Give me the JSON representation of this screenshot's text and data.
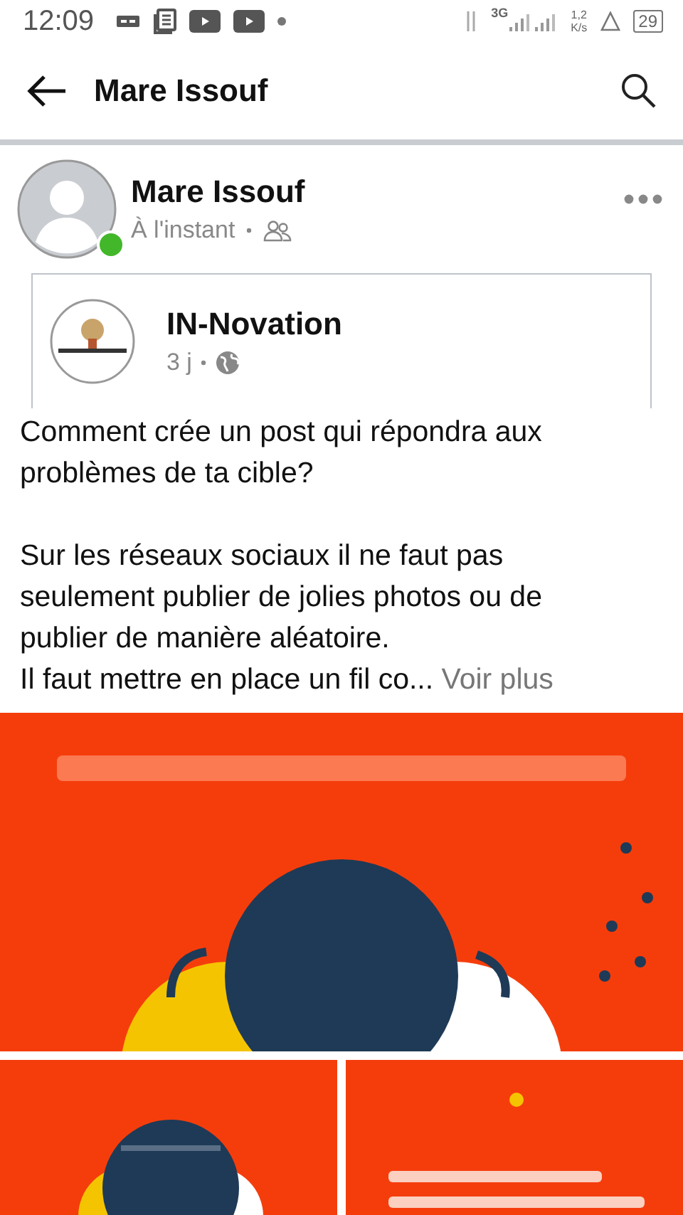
{
  "status_bar": {
    "time": "12:09",
    "network": "3G",
    "speed_value": "1,2",
    "speed_unit": "K/s",
    "battery": "29"
  },
  "header": {
    "title": "Mare Issouf"
  },
  "post": {
    "author": "Mare Issouf",
    "online": true,
    "time": "À l'instant",
    "shared": {
      "page": "IN-Novation",
      "time": "3 j"
    },
    "paragraphs": [
      [
        "Comment crée un post qui répondra aux",
        "problèmes de ta cible?"
      ],
      [
        "Sur les réseaux sociaux il ne faut pas",
        "seulement publier de jolies photos ou de",
        "publier de manière aléatoire.",
        "Il faut mettre en place un fil co..."
      ]
    ],
    "more": "Voir plus",
    "images": [
      {
        "kind": "picture"
      },
      {
        "kind": "picture"
      },
      {
        "kind": "picture"
      }
    ]
  }
}
